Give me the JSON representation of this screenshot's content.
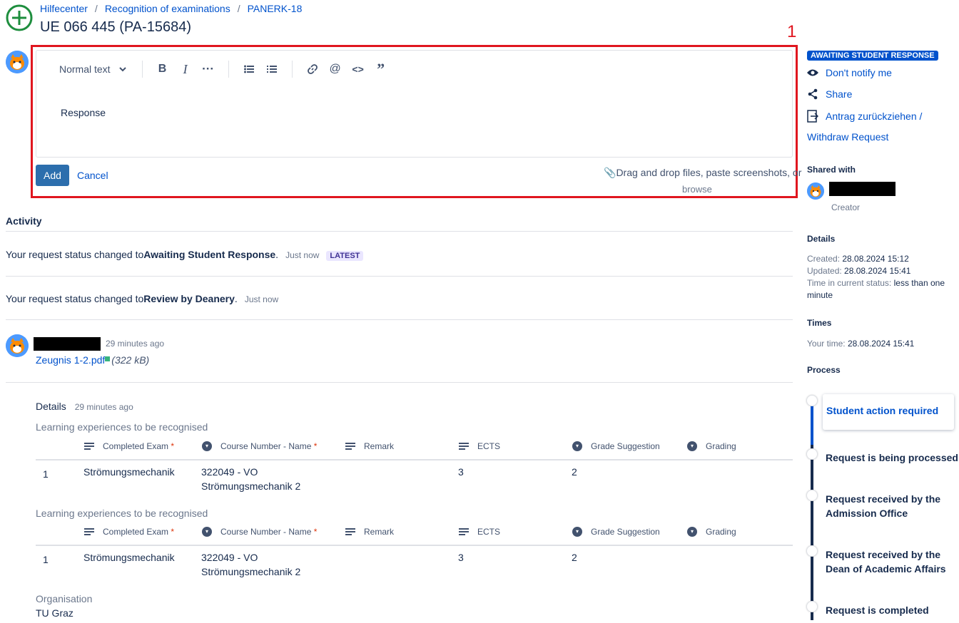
{
  "breadcrumb": [
    "Hilfecenter",
    "Recognition of examinations",
    "PANERK-18"
  ],
  "page_title": "UE 066 445 (PA-15684)",
  "annotation_label": "1",
  "editor": {
    "format_select": "Normal text",
    "content": "Response",
    "add_label": "Add",
    "cancel_label": "Cancel",
    "dnd_text": "Drag and drop files, paste screenshots, or",
    "browse_text": "browse"
  },
  "activity": {
    "title": "Activity",
    "items": [
      {
        "prefix": "Your request status changed to ",
        "status": "Awaiting Student Response",
        "suffix": ".",
        "time": "Just now",
        "badge": "LATEST"
      },
      {
        "prefix": "Your request status changed to ",
        "status": "Review by Deanery",
        "suffix": ".",
        "time": "Just now"
      }
    ],
    "attachment": {
      "time": "29 minutes ago",
      "file": "Zeugnis 1-2.pdf",
      "size": "(322 kB)"
    }
  },
  "details": {
    "title": "Details",
    "time": "29 minutes ago",
    "sections": [
      {
        "heading": "Learning experiences to be recognised",
        "columns": [
          "Completed Exam",
          "Course Number - Name",
          "Remark",
          "ECTS",
          "Grade Suggestion",
          "Grading"
        ],
        "rows": [
          {
            "index": "1",
            "exam": "Strömungsmechanik",
            "course_line1": "322049 - VO",
            "course_line2": "Strömungsmechanik 2",
            "remark": "",
            "ects": "3",
            "grade_suggestion": "2",
            "grading": ""
          }
        ]
      },
      {
        "heading": "Learning experiences to be recognised",
        "columns": [
          "Completed Exam",
          "Course Number - Name",
          "Remark",
          "ECTS",
          "Grade Suggestion",
          "Grading"
        ],
        "rows": [
          {
            "index": "1",
            "exam": "Strömungsmechanik",
            "course_line1": "322049 - VO",
            "course_line2": "Strömungsmechanik 2",
            "remark": "",
            "ects": "3",
            "grade_suggestion": "2",
            "grading": ""
          }
        ]
      }
    ],
    "organisation_label": "Organisation",
    "organisation_value": "TU Graz"
  },
  "sidebar": {
    "status": "AWAITING STUDENT RESPONSE",
    "notify": "Don't notify me",
    "share": "Share",
    "withdraw_line1": "Antrag zurückziehen /",
    "withdraw_line2": "Withdraw Request",
    "shared_with": "Shared with",
    "creator": "Creator",
    "details_h": "Details",
    "created_label": "Created:",
    "created_value": "28.08.2024 15:12",
    "updated_label": "Updated:",
    "updated_value": "28.08.2024 15:41",
    "time_status_label": "Time in current status:",
    "time_status_value": "less than one minute",
    "times_h": "Times",
    "your_time_label": "Your time:",
    "your_time_value": "28.08.2024 15:41",
    "process_h": "Process",
    "process_steps": [
      "Student action required",
      "Request is being processed",
      "Request received by the Admission Office",
      "Request received by the Dean of Academic Affairs",
      "Request is completed"
    ]
  },
  "colors": {
    "accent": "#0052cc",
    "highlight_box": "#e0161f",
    "add_button": "#2c6ead"
  }
}
